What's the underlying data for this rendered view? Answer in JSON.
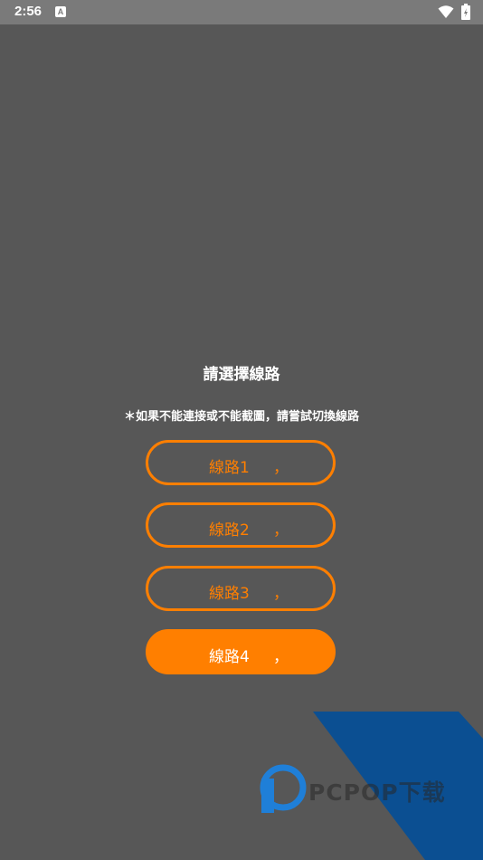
{
  "status_bar": {
    "time": "2:56",
    "notification_letter": "A"
  },
  "dialog": {
    "title": "請選擇線路",
    "notice": "＊如果不能連接或不能截圖，請嘗試切換線路",
    "lines": [
      {
        "label": "線路1",
        "suffix": "，",
        "selected": false
      },
      {
        "label": "線路2",
        "suffix": "，",
        "selected": false
      },
      {
        "label": "線路3",
        "suffix": "，",
        "selected": false
      },
      {
        "label": "線路4",
        "suffix": "，",
        "selected": true
      }
    ]
  },
  "watermark": {
    "text": "PCPOP下载",
    "icon": "pcpop-logo-icon"
  },
  "colors": {
    "background": "#575757",
    "status_bar": "#7a7a7a",
    "accent": "#ff7f00",
    "watermark_blue": "#0b4f92"
  }
}
